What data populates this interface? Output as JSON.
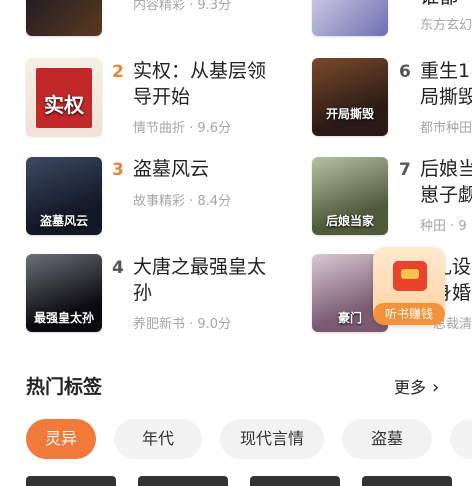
{
  "top_partial": {
    "left_meta": "内容精彩 · 9.3分",
    "right_title": "谁都",
    "right_meta": "东方玄幻"
  },
  "books_left": [
    {
      "rank": "2",
      "title_line1": "实权：从基层领",
      "title_line2": "导开始",
      "meta": "情节曲折 · 9.6分",
      "cover_text": "实权"
    },
    {
      "rank": "3",
      "title_line1": "盗墓风云",
      "title_line2": "",
      "meta": "故事精彩 · 8.4分",
      "cover_text": "盗墓风云"
    },
    {
      "rank": "4",
      "title_line1": "大唐之最强皇太",
      "title_line2": "孙",
      "meta": "养肥新书 · 9.0分",
      "cover_text": "最强皇太孙"
    }
  ],
  "books_right": [
    {
      "rank": "6",
      "title_line1": "重生1",
      "title_line2": "局撕毁",
      "meta": "都市种田",
      "cover_text": "开局撕毁"
    },
    {
      "rank": "7",
      "title_line1": "后娘当",
      "title_line2": "崽子觑",
      "meta": "种田 · 9",
      "cover_text": "后娘当家"
    },
    {
      "rank": "",
      "title_line1": "礼设",
      "title_line2": "身婚",
      "meta": "总裁清",
      "cover_text": "豪门"
    }
  ],
  "floating_badge": {
    "label": "听书赚钱",
    "icon": "red-envelope-icon"
  },
  "hot_tags": {
    "title": "热门标签",
    "more": "更多",
    "more_icon": "chevron-right-icon",
    "chips": [
      "灵异",
      "年代",
      "现代言情",
      "盗墓"
    ]
  },
  "colors": {
    "accent": "#f17a3a",
    "rank_highlight": "#e8833a"
  }
}
